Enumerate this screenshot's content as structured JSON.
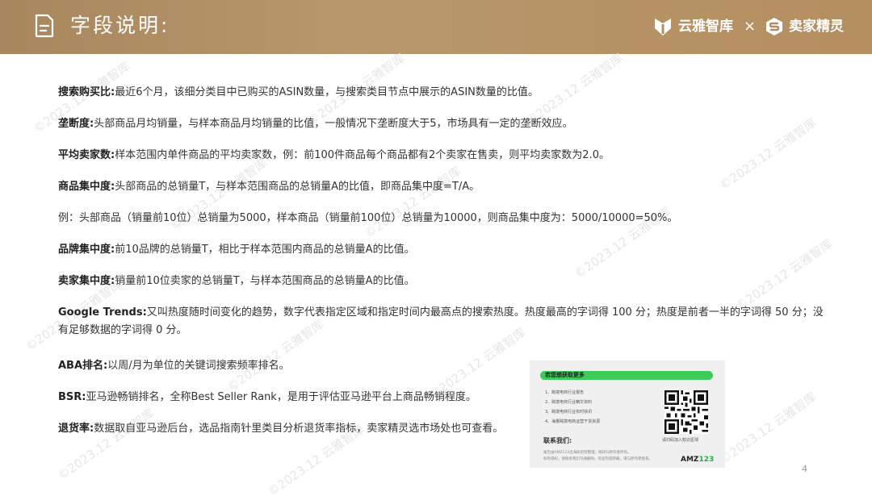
{
  "header": {
    "title": "字段说明:",
    "brand_left": "云雅智库",
    "separator": "×",
    "brand_right": "卖家精灵"
  },
  "watermark_text": "©2023.12 云雅智库",
  "rows": [
    {
      "term": "搜索购买比:",
      "desc": "最近6个月，该细分类目中已购买的ASIN数量，与搜索类目节点中展示的ASIN数量的比值。"
    },
    {
      "term": "垄断度:",
      "desc": "头部商品月均销量，与样本商品月均销量的比值，一般情况下垄断度大于5，市场具有一定的垄断效应。"
    },
    {
      "term": "平均卖家数:",
      "desc": "样本范围内单件商品的平均卖家数，例：前100件商品每个商品都有2个卖家在售卖，则平均卖家数为2.0。"
    },
    {
      "term": "商品集中度:",
      "desc": "头部商品的总销量T，与样本范围商品的总销量A的比值，即商品集中度=T/A。"
    },
    {
      "term": "",
      "desc": "例：头部商品（销量前10位）总销量为5000，样本商品（销量前100位）总销量为10000，则商品集中度为：5000/10000=50%。"
    },
    {
      "term": "品牌集中度:",
      "desc": "前10品牌的总销量T，相比于样本范围内商品的总销量A的比值。"
    },
    {
      "term": "卖家集中度:",
      "desc": "销量前10位卖家的总销量T，与样本范围商品的总销量A的比值。"
    },
    {
      "term": "Google Trends:",
      "desc": "又叫热度随时间变化的趋势，数字代表指定区域和指定时间内最高点的搜索热度。热度最高的字词得 100 分；热度是前者一半的字词得 50 分；没有足够数据的字词得 0 分。"
    },
    {
      "term": "ABA排名:",
      "desc": "以周/月为单位的关键词搜索频率排名。"
    },
    {
      "term": "BSR:",
      "desc": "亚马逊畅销排名，全称Best Seller Rank，是用于评估亚马逊平台上商品畅销程度。"
    },
    {
      "term": "退货率:",
      "desc": "数据取自亚马逊后台，选品指南针里类目分析退货率指标，卖家精灵选市场处也可查看。"
    }
  ],
  "card": {
    "bar_title": "若您想获取更多",
    "items": [
      "1、跨境电商行业报告",
      "2、跨境电商行业精华资料",
      "3、跨境电商行业实时快讯",
      "4、海量跨境电商运营干货资源"
    ],
    "contact_label": "联系我们:",
    "note_1": "报告由AMZ123出海研究院整理，版权归原作者所有。",
    "note_2": "如有侵权，请联系我们沟通删除。欢迎内容转载，请与原作者联系。",
    "qr_caption": "请扫码加入知识星球",
    "logo_main": "AMZ",
    "logo_num": "123"
  },
  "page_number": "4",
  "colors": {
    "header_bg": "#b08e63",
    "accent_green": "#3dcc5a"
  }
}
